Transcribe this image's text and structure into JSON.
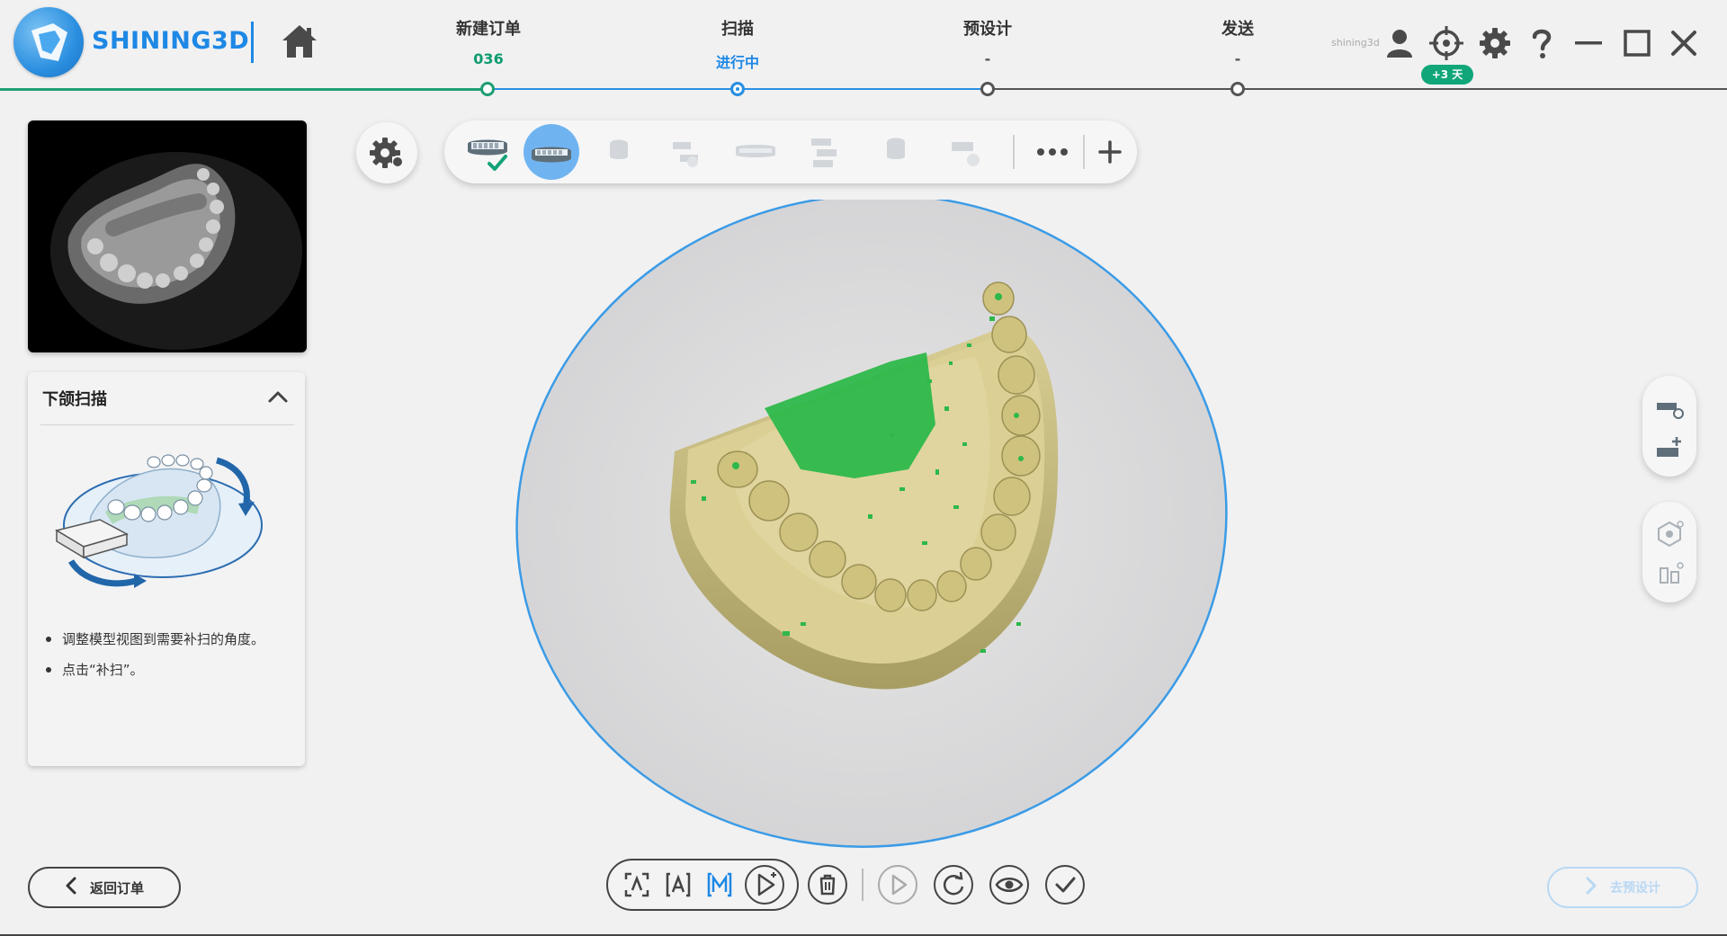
{
  "app": {
    "logo_text": "SHINING3D",
    "username": "shining3d",
    "days_badge": "+3 天"
  },
  "steps": [
    {
      "label": "新建订单",
      "sub": "036",
      "state": "done"
    },
    {
      "label": "扫描",
      "sub": "进行中",
      "state": "active"
    },
    {
      "label": "预设计",
      "sub": "-",
      "state": "pending"
    },
    {
      "label": "发送",
      "sub": "-",
      "state": "pending"
    }
  ],
  "guide": {
    "title": "下颌扫描",
    "tips": [
      "调整模型视图到需要补扫的角度。",
      "点击“补扫”。"
    ]
  },
  "buttons": {
    "back": "返回订单",
    "next": "去预设计"
  },
  "colors": {
    "accent_blue": "#2b8fe0",
    "accent_green": "#1f9e73",
    "model_beige": "#d9cf96",
    "highlight_green": "#2db84a"
  },
  "icons": {
    "header": [
      "home-icon",
      "user-icon",
      "target-icon",
      "settings-icon",
      "help-icon",
      "minimize-icon",
      "maximize-icon",
      "close-icon"
    ],
    "scan_toolbar": [
      "upper-jaw-done-icon",
      "lower-jaw-icon",
      "pre-op-upper-icon",
      "bite-icon",
      "pre-op-lower-icon",
      "occlusion-icon",
      "upper-abutment-icon",
      "lower-abutment-icon",
      "more-icon",
      "add-icon"
    ],
    "bottom_toolbar": [
      "auto-scan-icon",
      "auto-mode-icon",
      "manual-mode-icon",
      "start-scan-icon",
      "delete-icon",
      "play-icon",
      "refresh-icon",
      "view-icon",
      "confirm-icon"
    ],
    "side_tools": [
      "trim-tool-icon",
      "add-tool-icon",
      "lock-region-icon",
      "auto-trim-icon"
    ]
  }
}
